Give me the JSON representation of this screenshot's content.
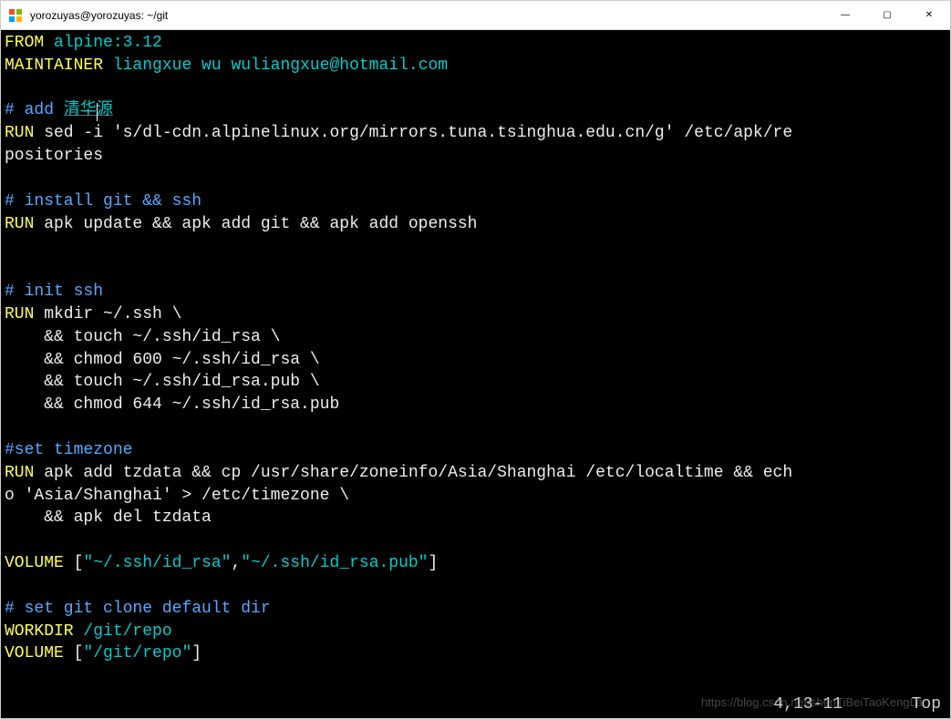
{
  "titlebar": {
    "title": "yorozuyas@yorozuyas: ~/git"
  },
  "win_controls": {
    "minimize": "—",
    "maximize": "▢",
    "close": "✕"
  },
  "lines": {
    "l1_kw": "FROM",
    "l1_val": " alpine:3.12",
    "l2_kw": "MAINTAINER",
    "l2_val": " liangxue wu wuliangxue@hotmail.com",
    "l3_comment_pre": "# add ",
    "l3_comment_cjk": "清华源",
    "l4_kw": "RUN",
    "l4_val": " sed -i 's/dl-cdn.alpinelinux.org/mirrors.tuna.tsinghua.edu.cn/g' /etc/apk/re",
    "l5_val": "positories",
    "l6_comment": "# install git && ssh",
    "l7_kw": "RUN",
    "l7_val": " apk update && apk add git && apk add openssh",
    "l8_comment": "# init ssh",
    "l9_kw": "RUN",
    "l9_val": " mkdir ~/.ssh \\",
    "l10_val": "    && touch ~/.ssh/id_rsa \\",
    "l11_val": "    && chmod 600 ~/.ssh/id_rsa \\",
    "l12_val": "    && touch ~/.ssh/id_rsa.pub \\",
    "l13_val": "    && chmod 644 ~/.ssh/id_rsa.pub",
    "l14_comment": "#set timezone",
    "l15_kw": "RUN",
    "l15_val": " apk add tzdata && cp /usr/share/zoneinfo/Asia/Shanghai /etc/localtime && ech",
    "l16_val": "o 'Asia/Shanghai' > /etc/timezone \\",
    "l17_val": "    && apk del tzdata",
    "l18_kw": "VOLUME",
    "l18_val1": " [",
    "l18_str1": "\"~/.ssh/id_rsa\"",
    "l18_comma": ",",
    "l18_str2": "\"~/.ssh/id_rsa.pub\"",
    "l18_val2": "]",
    "l19_comment": "# set git clone default dir",
    "l20_kw": "WORKDIR",
    "l20_val": " /git/repo",
    "l21_kw": "VOLUME",
    "l21_val1": " [",
    "l21_str": "\"/git/repo\"",
    "l21_val2": "]"
  },
  "status": {
    "pos": "4,13-11       Top"
  },
  "watermark": "https://blog.csdn.net/shenTiBeiTaoKengLa"
}
